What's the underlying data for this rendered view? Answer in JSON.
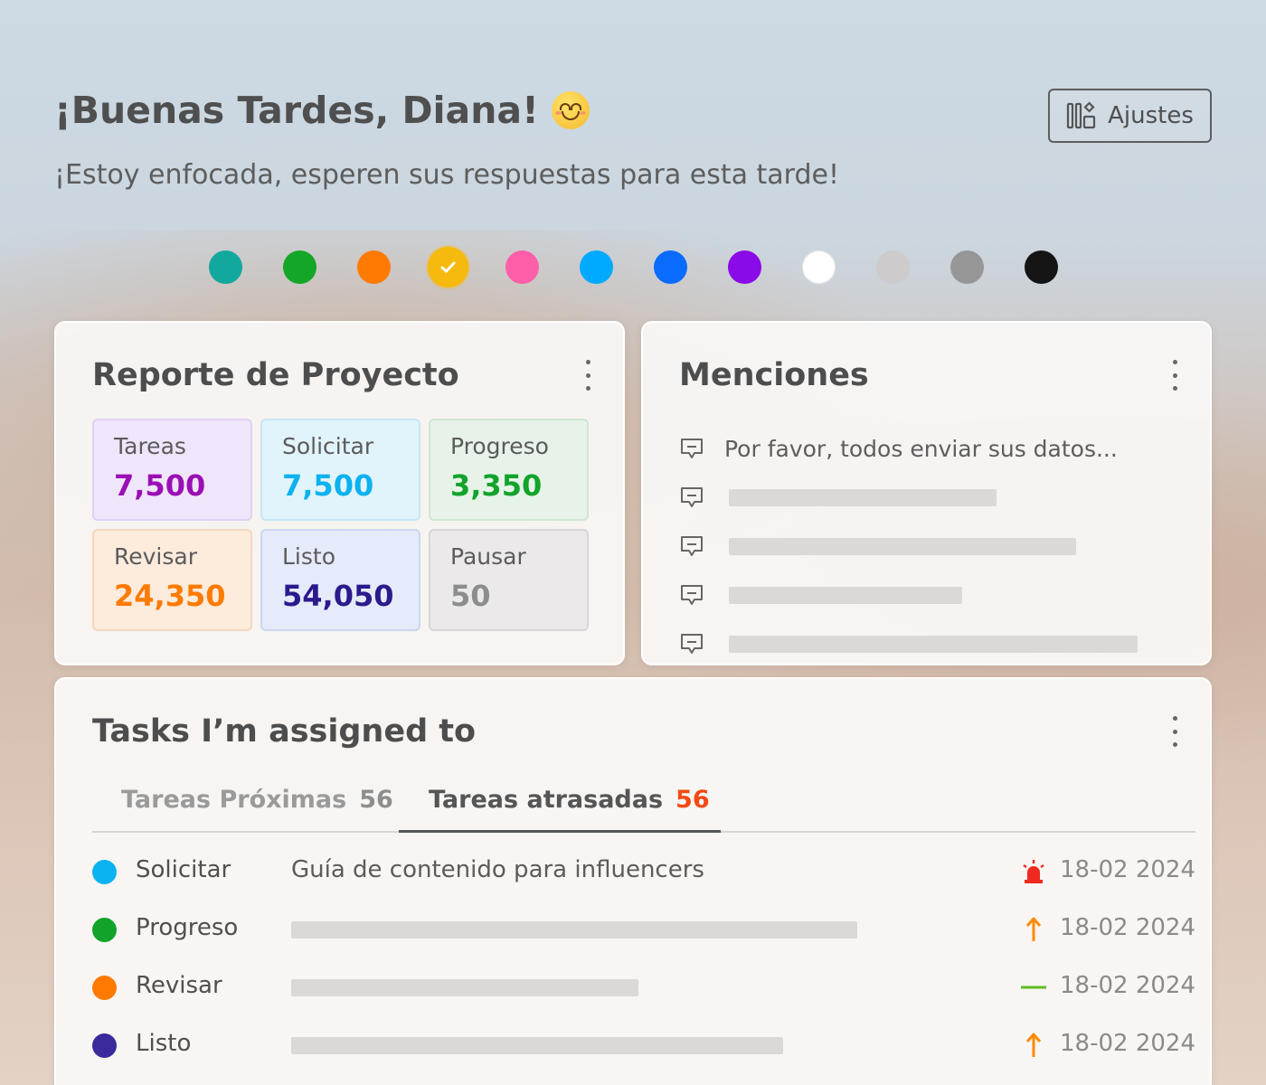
{
  "header": {
    "greeting": "¡Buenas Tardes, Diana!",
    "emoji": "smiling-face",
    "subtitle": "¡Estoy enfocada, esperen sus respuestas para esta tarde!",
    "settings_label": "Ajustes",
    "settings_icon": "layout-settings-icon"
  },
  "theme_colors": {
    "swatches": [
      "#13a89e",
      "#14a627",
      "#ff7a00",
      "#f6ba0e",
      "#ff5fa8",
      "#00aaff",
      "#0a6bff",
      "#8a0ae8",
      "#ffffff",
      "#cdcbcb",
      "#969696",
      "#141414"
    ],
    "selected": "#f6ba0e"
  },
  "report": {
    "title": "Reporte de Proyecto",
    "stats": [
      {
        "label": "Tareas",
        "value": "7,500",
        "color": "#9a0fb5",
        "bg": "#f0e6fb",
        "border": "#e0d0f3"
      },
      {
        "label": "Solicitar",
        "value": "7,500",
        "color": "#0ab2f0",
        "bg": "#e1f3fb",
        "border": "#c6e6f4"
      },
      {
        "label": "Progreso",
        "value": "3,350",
        "color": "#12a32b",
        "bg": "#e7f3e8",
        "border": "#cfe6d1"
      },
      {
        "label": "Revisar",
        "value": "24,350",
        "color": "#ff7a00",
        "bg": "#fdebdc",
        "border": "#f4d7c0"
      },
      {
        "label": "Listo",
        "value": "54,050",
        "color": "#2b1a8c",
        "bg": "#e6ebfb",
        "border": "#ccd6f4"
      },
      {
        "label": "Pausar",
        "value": "50",
        "color": "#8d8d8d",
        "bg": "#ebe9e9",
        "border": "#d9d6d6"
      }
    ]
  },
  "mentions": {
    "title": "Menciones",
    "items": [
      {
        "text": "Por favor, todos enviar sus datos..."
      },
      {
        "text": ""
      },
      {
        "text": ""
      },
      {
        "text": ""
      },
      {
        "text": ""
      }
    ]
  },
  "tasks": {
    "title": "Tasks I’m assigned to",
    "tabs": [
      {
        "label": "Tareas Próximas",
        "count": "56",
        "count_color": "#8d8d8d",
        "active": false
      },
      {
        "label": "Tareas atrasadas",
        "count": "56",
        "count_color": "#f24a12",
        "active": true
      }
    ],
    "rows": [
      {
        "status": "Solicitar",
        "dot_color": "#0ab2f0",
        "name": "Guía de contenido para influencers",
        "priority": "alarm-icon",
        "date": "18-02 2024"
      },
      {
        "status": "Progreso",
        "dot_color": "#12a32b",
        "name": "",
        "priority": "arrow-up-icon",
        "date": "18-02 2024"
      },
      {
        "status": "Revisar",
        "dot_color": "#ff7a00",
        "name": "",
        "priority": "dash-icon",
        "date": "18-02 2024"
      },
      {
        "status": "Listo",
        "dot_color": "#3b2a9c",
        "name": "",
        "priority": "arrow-up-icon",
        "date": "18-02 2024"
      }
    ]
  }
}
